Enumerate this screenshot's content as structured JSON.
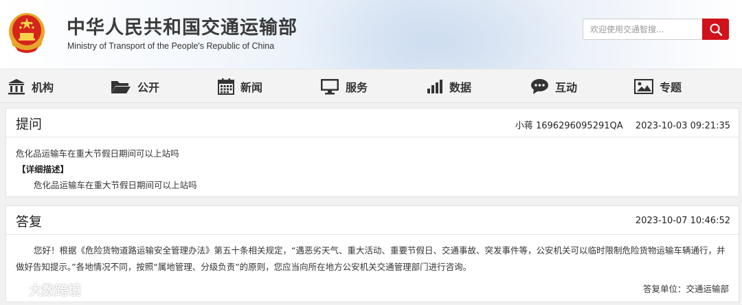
{
  "header": {
    "title_cn": "中华人民共和国交通运输部",
    "title_en": "Ministry of Transport of the People's Republic of China",
    "search_placeholder": "欢迎使用交通智搜...",
    "accent_color": "#d0121b"
  },
  "nav": {
    "items": [
      {
        "label": "机构",
        "icon": "building-icon"
      },
      {
        "label": "公开",
        "icon": "folder-icon"
      },
      {
        "label": "新闻",
        "icon": "calendar-icon"
      },
      {
        "label": "服务",
        "icon": "monitor-icon"
      },
      {
        "label": "数据",
        "icon": "bar-chart-icon"
      },
      {
        "label": "互动",
        "icon": "chat-bubble-icon"
      },
      {
        "label": "专题",
        "icon": "image-icon"
      }
    ]
  },
  "question": {
    "heading": "提问",
    "author": "小蒋 1696296095291QA",
    "datetime": "2023-10-03 09:21:35",
    "subject": "危化品运输车在重大节假日期间可以上站吗",
    "detail_label": "【详细描述】",
    "detail_text": "危化品运输车在重大节假日期间可以上站吗"
  },
  "answer": {
    "heading": "答复",
    "datetime": "2023-10-07 10:46:52",
    "body": "您好！根据《危险货物道路运输安全管理办法》第五十条相关规定，“遇恶劣天气、重大活动、重要节假日、交通事故、突发事件等，公安机关可以临时限制危险货物运输车辆通行，并做好告知提示。”各地情况不同，按照“属地管理、分级负责”的原则，您应当向所在地方公安机关交通管理部门进行咨询。",
    "unit": "答复单位：交通运输部"
  },
  "watermark": {
    "text": "大数跨境"
  }
}
